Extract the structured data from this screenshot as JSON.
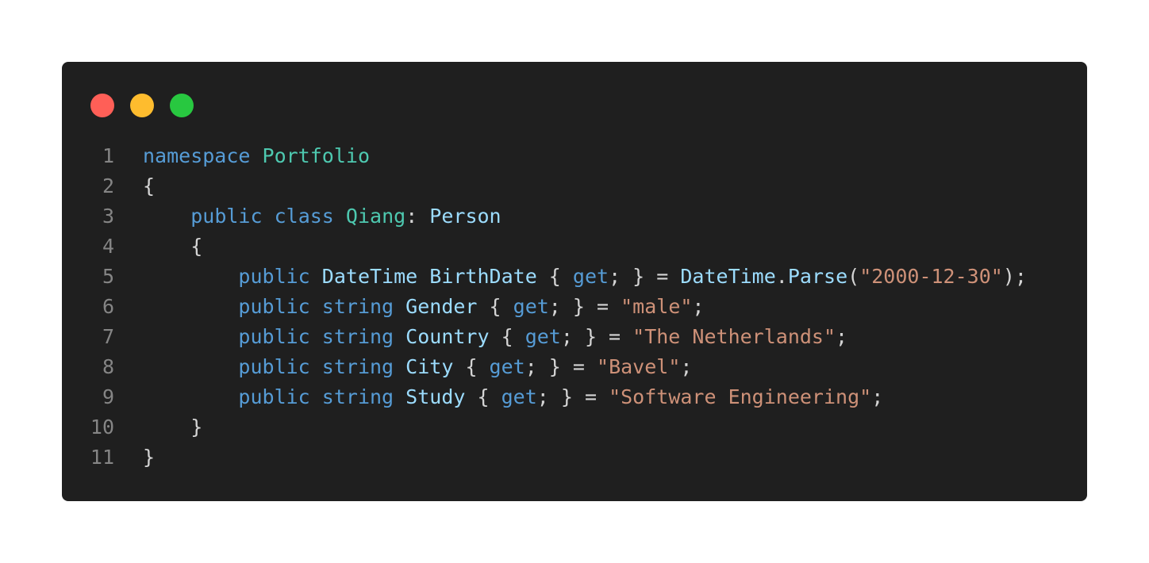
{
  "colors": {
    "background": "#ffffff",
    "editor_bg": "#1f1f1f",
    "dot_close": "#ff5f57",
    "dot_minimize": "#febc2e",
    "dot_maximize": "#28c840",
    "line_number": "#858585",
    "keyword": "#569cd6",
    "type": "#4ec9b0",
    "identifier": "#9cdcfe",
    "string": "#ce9178",
    "punctuation": "#d4d4d4"
  },
  "code": {
    "lines": [
      {
        "num": "1",
        "tokens": [
          {
            "t": "namespace",
            "c": "kw"
          },
          {
            "t": " ",
            "c": "pu"
          },
          {
            "t": "Portfolio",
            "c": "ty"
          }
        ]
      },
      {
        "num": "2",
        "tokens": [
          {
            "t": "{",
            "c": "pu"
          }
        ]
      },
      {
        "num": "3",
        "tokens": [
          {
            "t": "    ",
            "c": "pu"
          },
          {
            "t": "public",
            "c": "kw"
          },
          {
            "t": " ",
            "c": "pu"
          },
          {
            "t": "class",
            "c": "kw"
          },
          {
            "t": " ",
            "c": "pu"
          },
          {
            "t": "Qiang",
            "c": "ty"
          },
          {
            "t": ": ",
            "c": "pu"
          },
          {
            "t": "Person",
            "c": "id"
          }
        ]
      },
      {
        "num": "4",
        "tokens": [
          {
            "t": "    {",
            "c": "pu"
          }
        ]
      },
      {
        "num": "5",
        "tokens": [
          {
            "t": "        ",
            "c": "pu"
          },
          {
            "t": "public",
            "c": "kw"
          },
          {
            "t": " ",
            "c": "pu"
          },
          {
            "t": "DateTime",
            "c": "id"
          },
          {
            "t": " ",
            "c": "pu"
          },
          {
            "t": "BirthDate",
            "c": "id"
          },
          {
            "t": " { ",
            "c": "pu"
          },
          {
            "t": "get",
            "c": "kw"
          },
          {
            "t": "; } = ",
            "c": "pu"
          },
          {
            "t": "DateTime",
            "c": "id"
          },
          {
            "t": ".",
            "c": "pu"
          },
          {
            "t": "Parse",
            "c": "id"
          },
          {
            "t": "(",
            "c": "pu"
          },
          {
            "t": "\"2000-12-30\"",
            "c": "str"
          },
          {
            "t": ");",
            "c": "pu"
          }
        ]
      },
      {
        "num": "6",
        "tokens": [
          {
            "t": "        ",
            "c": "pu"
          },
          {
            "t": "public",
            "c": "kw"
          },
          {
            "t": " ",
            "c": "pu"
          },
          {
            "t": "string",
            "c": "kw"
          },
          {
            "t": " ",
            "c": "pu"
          },
          {
            "t": "Gender",
            "c": "id"
          },
          {
            "t": " { ",
            "c": "pu"
          },
          {
            "t": "get",
            "c": "kw"
          },
          {
            "t": "; } = ",
            "c": "pu"
          },
          {
            "t": "\"male\"",
            "c": "str"
          },
          {
            "t": ";",
            "c": "pu"
          }
        ]
      },
      {
        "num": "7",
        "tokens": [
          {
            "t": "        ",
            "c": "pu"
          },
          {
            "t": "public",
            "c": "kw"
          },
          {
            "t": " ",
            "c": "pu"
          },
          {
            "t": "string",
            "c": "kw"
          },
          {
            "t": " ",
            "c": "pu"
          },
          {
            "t": "Country",
            "c": "id"
          },
          {
            "t": " { ",
            "c": "pu"
          },
          {
            "t": "get",
            "c": "kw"
          },
          {
            "t": "; } = ",
            "c": "pu"
          },
          {
            "t": "\"The Netherlands\"",
            "c": "str"
          },
          {
            "t": ";",
            "c": "pu"
          }
        ]
      },
      {
        "num": "8",
        "tokens": [
          {
            "t": "        ",
            "c": "pu"
          },
          {
            "t": "public",
            "c": "kw"
          },
          {
            "t": " ",
            "c": "pu"
          },
          {
            "t": "string",
            "c": "kw"
          },
          {
            "t": " ",
            "c": "pu"
          },
          {
            "t": "City",
            "c": "id"
          },
          {
            "t": " { ",
            "c": "pu"
          },
          {
            "t": "get",
            "c": "kw"
          },
          {
            "t": "; } = ",
            "c": "pu"
          },
          {
            "t": "\"Bavel\"",
            "c": "str"
          },
          {
            "t": ";",
            "c": "pu"
          }
        ]
      },
      {
        "num": "9",
        "tokens": [
          {
            "t": "        ",
            "c": "pu"
          },
          {
            "t": "public",
            "c": "kw"
          },
          {
            "t": " ",
            "c": "pu"
          },
          {
            "t": "string",
            "c": "kw"
          },
          {
            "t": " ",
            "c": "pu"
          },
          {
            "t": "Study",
            "c": "id"
          },
          {
            "t": " { ",
            "c": "pu"
          },
          {
            "t": "get",
            "c": "kw"
          },
          {
            "t": "; } = ",
            "c": "pu"
          },
          {
            "t": "\"Software Engineering\"",
            "c": "str"
          },
          {
            "t": ";",
            "c": "pu"
          }
        ]
      },
      {
        "num": "10",
        "tokens": [
          {
            "t": "    }",
            "c": "pu"
          }
        ]
      },
      {
        "num": "11",
        "tokens": [
          {
            "t": "}",
            "c": "pu"
          }
        ]
      }
    ]
  }
}
